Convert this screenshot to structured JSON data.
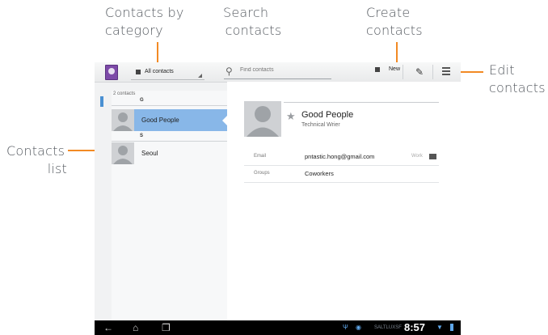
{
  "annotations": {
    "contacts_by_category": [
      "Contacts by",
      "category"
    ],
    "search_contacts": [
      "Search",
      "contacts"
    ],
    "create_contacts": [
      "Create",
      "contacts"
    ],
    "edit_contacts": [
      "Edit",
      "contacts"
    ],
    "contacts_list": [
      "Contacts",
      "list"
    ]
  },
  "action_bar": {
    "category_selected": "All contacts",
    "search_placeholder": "Find contacts",
    "new_label": "New"
  },
  "contact_list": {
    "count_text": "2 contacts",
    "sections": [
      {
        "letter": "G",
        "contacts": [
          {
            "name": "Good People",
            "selected": true
          }
        ]
      },
      {
        "letter": "S",
        "contacts": [
          {
            "name": "Seoul",
            "selected": false
          }
        ]
      }
    ]
  },
  "detail": {
    "name": "Good People",
    "title": "Technical Wrier",
    "fields": [
      {
        "label": "Email",
        "value": "pntastic.hong@gmail.com",
        "type": "Work"
      },
      {
        "label": "Groups",
        "value": "Coworkers"
      }
    ]
  },
  "system_bar": {
    "carrier": "SALTLUXSF",
    "time": "8:57"
  },
  "colors": {
    "accent_orange": "#f28a24",
    "selection_blue": "#88b7e8",
    "system_icon_blue": "#5fa7ea"
  },
  "icons": [
    "app-contacts-icon",
    "group-flag-icon",
    "search-icon",
    "new-contact-icon",
    "edit-pencil-icon",
    "overflow-menu-icon",
    "star-icon",
    "email-icon",
    "back-icon",
    "home-icon",
    "recent-apps-icon",
    "usb-icon",
    "wifi-icon",
    "battery-icon"
  ]
}
